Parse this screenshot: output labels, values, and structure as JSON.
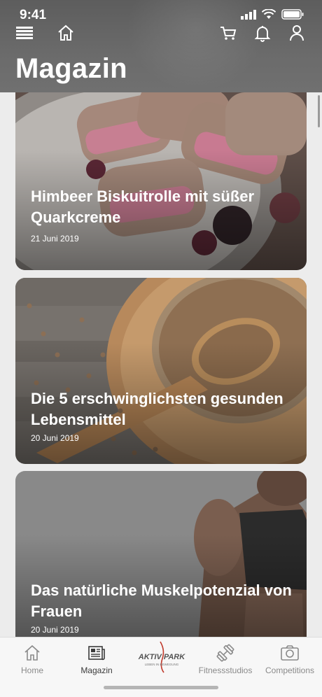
{
  "status_bar": {
    "time": "9:41"
  },
  "header": {
    "title": "Magazin"
  },
  "articles": [
    {
      "title": "Himbeer Biskuitrolle mit süßer Quarkcreme",
      "date": "21 Juni 2019",
      "image": "raspberry-roll-photo"
    },
    {
      "title": "Die 5 erschwinglichsten gesunden Lebensmittel",
      "date": "20 Juni 2019",
      "image": "lentils-photo"
    },
    {
      "title": "Das natürliche Muskelpotenzial von Frauen",
      "date": "20 Juni 2019",
      "image": "athlete-photo"
    }
  ],
  "tabbar": {
    "home": "Home",
    "magazin": "Magazin",
    "fitnessstudios": "Fitnessstudios",
    "competitions": "Competitions",
    "logo_main": "AKTIV PARK",
    "logo_sub": "LEBEN IN BEWEGUNG"
  },
  "colors": {
    "header_bg": "#666666",
    "tab_active": "#3a3a3a",
    "tab_inactive": "#8a8a8a"
  },
  "icons": [
    "menu-icon",
    "home-icon",
    "cart-icon",
    "bell-icon",
    "user-icon",
    "home-tab-icon",
    "newspaper-icon",
    "dumbbell-icon",
    "camera-icon"
  ]
}
